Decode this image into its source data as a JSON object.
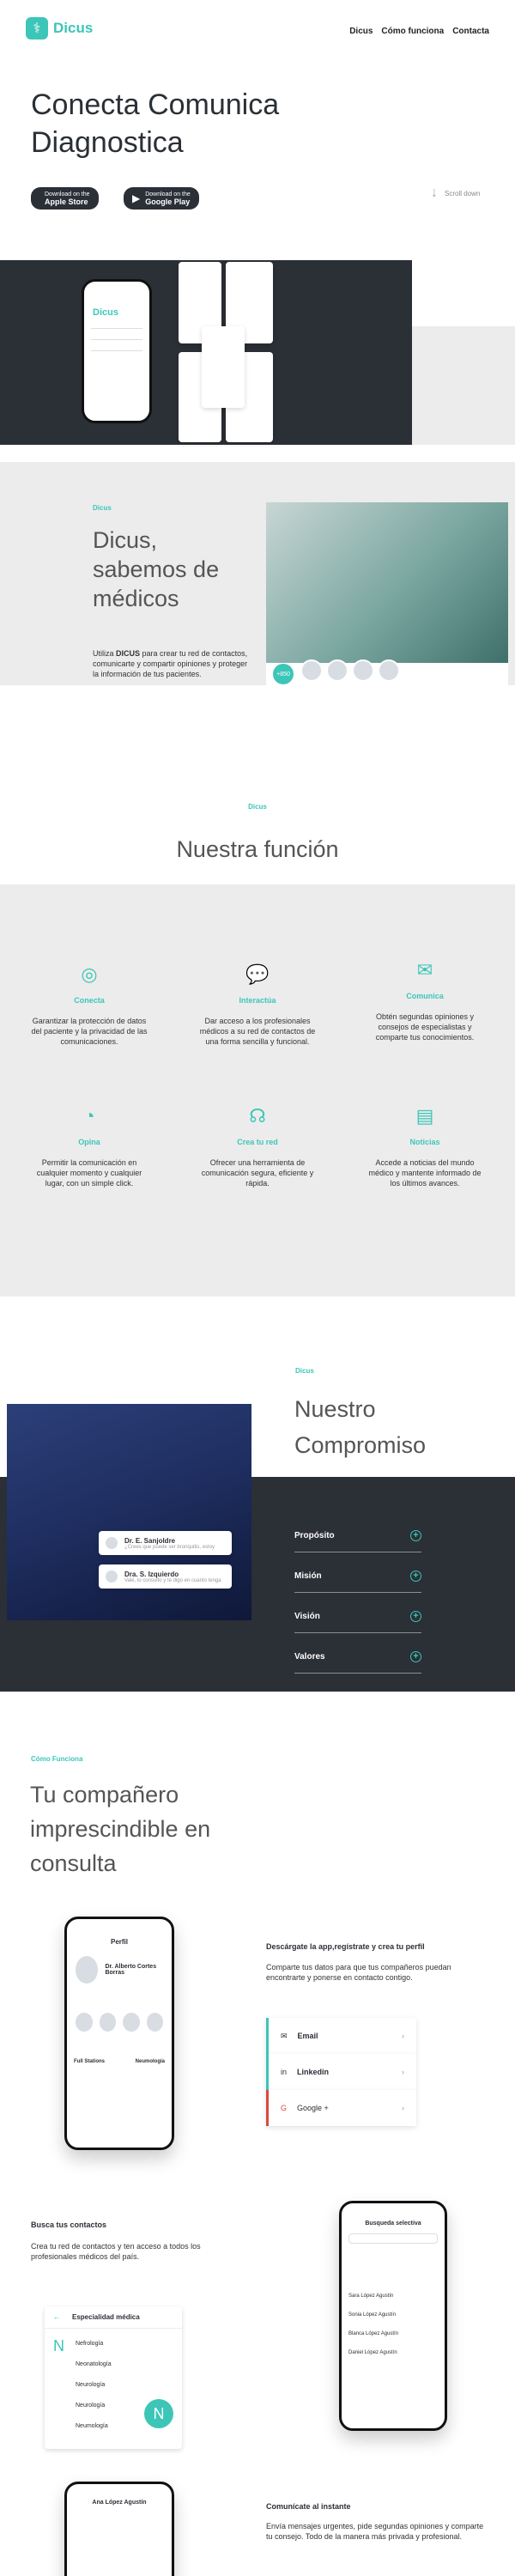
{
  "brand": {
    "name": "Dicus"
  },
  "nav": {
    "items": [
      "Dicus",
      "Cómo funciona",
      "Contacta"
    ]
  },
  "hero": {
    "title_line1": "Conecta Comunica",
    "title_line2": "Diagnostica",
    "app_store_small": "Download on the",
    "app_store": "Apple Store",
    "google_small": "Download on the",
    "google": "Google Play",
    "scroll": "Scroll down"
  },
  "about": {
    "kicker": "Dicus",
    "title_1": "Dicus,",
    "title_2": "sabemos de",
    "title_3": "médicos",
    "body_pre": "Utiliza ",
    "body_bold": "DICUS",
    "body_post": " para crear tu red de contactos, comunicarte y compartir opiniones y proteger la información de tus pacientes.",
    "badge": "+850"
  },
  "funcion": {
    "kicker": "Dicus",
    "title": "Nuestra función",
    "features": [
      {
        "icon": "globe-icon",
        "title": "Conecta",
        "text": "Garantizar la protección de datos del paciente y la privacidad de las comunicaciones."
      },
      {
        "icon": "chat-icon",
        "title": "Interactúa",
        "text": "Dar acceso a los profesionales médicos a su red de contactos de una forma sencilla y funcional."
      },
      {
        "icon": "megaphone-icon",
        "title": "Comunica",
        "text": "Obtén segundas opiniones y consejos de especialistas y comparte tus conocimientos."
      },
      {
        "icon": "lightbulb-icon",
        "title": "Opina",
        "text": "Permitir la comunicación en cualquier momento y cualquier lugar, con un simple click."
      },
      {
        "icon": "network-icon",
        "title": "Crea tu red",
        "text": "Ofrecer una herramienta de comunicación segura, eficiente y rápida."
      },
      {
        "icon": "news-icon",
        "title": "Noticias",
        "text": "Accede a noticias del mundo médico y mantente informado de los últimos avances."
      }
    ]
  },
  "compromiso": {
    "kicker": "Dicus",
    "title_1": "Nuestro",
    "title_2": "Compromiso",
    "items": [
      "Propósito",
      "Misión",
      "Visión",
      "Valores"
    ],
    "doctor1": "Dr. E. Sanjoldre",
    "doctor1_sub": "¿Crees que puede ser bronquitis, estoy",
    "doctor2": "Dra. S. Izquierdo",
    "doctor2_sub": "Vale, lo consulto y te digo en cuanto tenga"
  },
  "como": {
    "kicker": "Cómo Funciona",
    "title_1": "Tu compañero",
    "title_2": "imprescindible en",
    "title_3": "consulta",
    "step1_title": "Descárgate la app,regístrate y crea tu perfil",
    "step1_text": "Comparte tus datos para que tus compañeros puedan encontrarte y ponerse en contacto contigo.",
    "socials": [
      {
        "icon": "email-icon",
        "label": "Email"
      },
      {
        "icon": "linkedin-icon",
        "label": "Linkedin"
      },
      {
        "icon": "google-icon",
        "label": "Google +"
      }
    ],
    "step2_title": "Busca tus contactos",
    "step2_text": "Crea tu red de contactos y ten acceso a todos los profesionales médicos del país.",
    "esp_title": "Especialidad médica",
    "esp_letter": "N",
    "esp_items": [
      "Nefrología",
      "Neonatología",
      "Neurología",
      "Neurología",
      "Neumología"
    ],
    "step3_title": "Comunícate al instante",
    "step3_text": "Envía mensajes urgentes, pide segundas opiniones y comparte tu consejo. Todo de la manera más privada y profesional.",
    "phone1_title": "Perfil",
    "phone1_name": "Dr. Alberto Cortes Borras",
    "phone1_tab1": "Full Stations",
    "phone1_tab2": "Neumología",
    "phone2_title": "Busqueda selectiva",
    "phone2_list": [
      "Sara López Agustín",
      "Sonia López Agustín",
      "Blanca López Agustín",
      "Daniel López Agustín"
    ],
    "phone3_title": "Ana López Agustín"
  },
  "colors": {
    "accent": "#3cc6b8",
    "dark": "#2b2f36",
    "grey": "#ececec"
  }
}
